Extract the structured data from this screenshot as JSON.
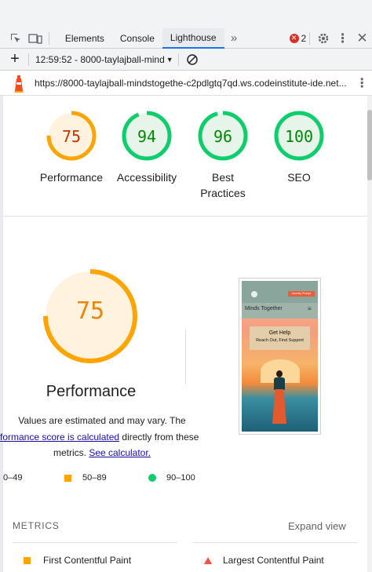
{
  "devtools": {
    "tabs": [
      "Elements",
      "Console",
      "Lighthouse"
    ],
    "active_tab": "Lighthouse",
    "error_count": "2",
    "report_label": "12:59:52 - 8000-taylajball-mind",
    "url": "https://8000-taylajball-mindstogethe-c2pdlgtq7qd.ws.codeinstitute-ide.net..."
  },
  "scores": [
    {
      "label": "Performance",
      "value": 75,
      "color": "#ffa400",
      "fill": "#fff3e0",
      "text_color": "#c33300"
    },
    {
      "label": "Accessibility",
      "value": 94,
      "color": "#0cce6b",
      "fill": "#e6f4ea",
      "text_color": "#008800"
    },
    {
      "label": "Best Practices",
      "value": 96,
      "color": "#0cce6b",
      "fill": "#e6f4ea",
      "text_color": "#008800"
    },
    {
      "label": "SEO",
      "value": 100,
      "color": "#0cce6b",
      "fill": "#e6f4ea",
      "text_color": "#008800"
    }
  ],
  "labels": {
    "score_0": "Performance",
    "score_1": "Accessibility",
    "score_2a": "Best",
    "score_2b": "Practices",
    "score_3": "SEO",
    "score_0_val": "75",
    "score_1_val": "94",
    "score_2_val": "96",
    "score_3_val": "100"
  },
  "performance": {
    "value": "75",
    "fraction": 0.75,
    "title": "Performance",
    "note_line1": "Values are estimated and may vary. The",
    "note_link1": "rformance score is calculated",
    "note_line2_rest": " directly from these",
    "note_line3_pre": "metrics. ",
    "note_link2": "See calculator.",
    "legend_fail": "0–49",
    "legend_avg": "50–89",
    "legend_pass": "90–100"
  },
  "preview": {
    "nav_button": "Journey Prompt",
    "brand": "Minds Together",
    "hero_line1": "Get Help",
    "hero_line2": "Reach Out, Find Support"
  },
  "metrics": {
    "title": "METRICS",
    "expand": "Expand view",
    "items": [
      "First Contentful Paint",
      "Largest Contentful Paint"
    ]
  },
  "colors": {
    "average": "#ffa400",
    "pass": "#0cce6b",
    "fail": "#ff4e42",
    "link": "#1a0dab"
  }
}
